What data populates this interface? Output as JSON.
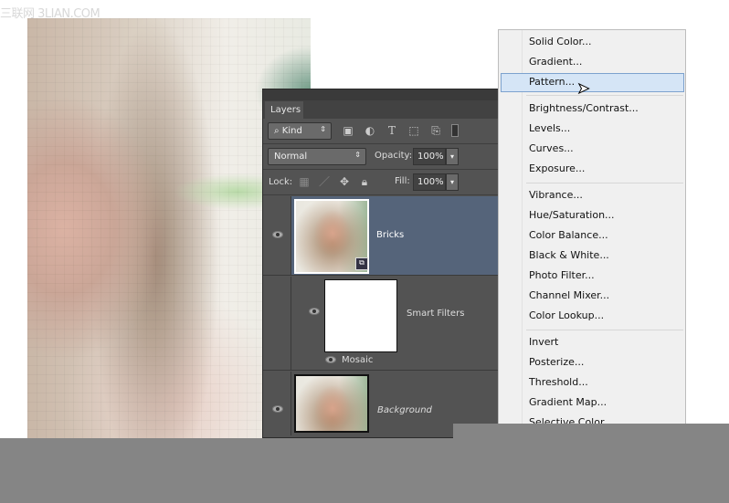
{
  "watermark": "三联网 3LIAN.COM",
  "layers_panel": {
    "tab": "Layers",
    "filter_kind": "Kind",
    "blend_mode": "Normal",
    "opacity_label": "Opacity:",
    "opacity": "100%",
    "lock_label": "Lock:",
    "fill_label": "Fill:",
    "fill": "100%",
    "layers": [
      {
        "name": "Bricks",
        "selected": true
      },
      {
        "name": "Smart Filters",
        "filter": "Mosaic"
      },
      {
        "name": "Background"
      }
    ]
  },
  "menu": {
    "items": [
      "Solid Color...",
      "Gradient...",
      "Pattern...",
      "Brightness/Contrast...",
      "Levels...",
      "Curves...",
      "Exposure...",
      "Vibrance...",
      "Hue/Saturation...",
      "Color Balance...",
      "Black & White...",
      "Photo Filter...",
      "Channel Mixer...",
      "Color Lookup...",
      "Invert",
      "Posterize...",
      "Threshold...",
      "Gradient Map...",
      "Selective Color..."
    ],
    "highlighted": "Pattern..."
  },
  "colors": {
    "selected_layer": "#55647a",
    "menu_highlight": "#d5e5f6",
    "panel_bg": "#535353"
  }
}
